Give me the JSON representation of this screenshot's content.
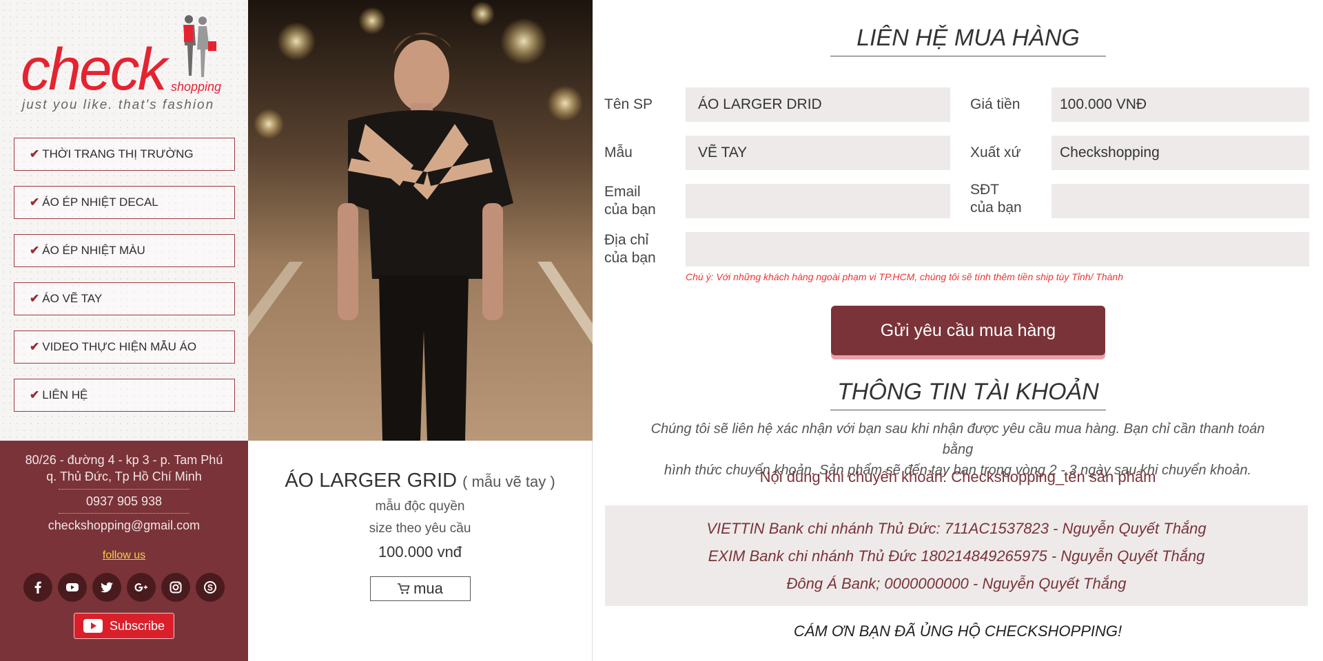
{
  "brand": {
    "logo_word": "check",
    "logo_sub": "shopping",
    "tagline": "just you like. that's fashion",
    "accent_color": "#e52330",
    "dark_color": "#7a3338"
  },
  "menu": {
    "items": [
      {
        "label": "THỜI TRANG THỊ TRƯỜNG"
      },
      {
        "label": "ÁO ÉP NHIỆT DECAL"
      },
      {
        "label": "ÁO ÉP NHIỆT MÀU"
      },
      {
        "label": "ÁO VẼ TAY"
      },
      {
        "label": "VIDEO THỰC HIỆN MẪU ÁO"
      },
      {
        "label": "LIÊN HỆ"
      }
    ],
    "check_icon": "check-icon"
  },
  "contact": {
    "address_line1": "80/26 - đường 4 - kp 3 - p. Tam Phú",
    "address_line2": "q. Thủ Đức, Tp Hồ Chí Minh",
    "phone": "0937 905 938",
    "email": "checkshopping@gmail.com",
    "follow_label": "follow us",
    "socials": [
      "facebook-icon",
      "youtube-icon",
      "twitter-icon",
      "google-plus-icon",
      "instagram-icon",
      "skype-icon"
    ],
    "subscribe_label": "Subscribe"
  },
  "product": {
    "name": "ÁO LARGER GRID",
    "style": "( mẫu vẽ tay )",
    "line1": "mẫu độc quyền",
    "line2": "size theo yêu cầu",
    "price": "100.000 vnđ",
    "buy_label": "mua"
  },
  "order_form": {
    "title": "LIÊN HỆ MUA HÀNG",
    "product_label": "Tên SP",
    "product_value": "ÁO LARGER DRID",
    "price_label": "Giá tiền",
    "price_value": "100.000 VNĐ",
    "design_label": "Mẫu",
    "design_value": "VẼ TAY",
    "origin_label": "Xuất xứ",
    "origin_value": "Checkshopping",
    "email_label_1": "Email",
    "email_label_2": "của bạn",
    "email_value": "",
    "phone_label_1": "SĐT",
    "phone_label_2": "của bạn",
    "phone_value": "",
    "address_label_1": "Địa chỉ",
    "address_label_2": "của bạn",
    "address_value": "",
    "note": "Chú ý: Với những khách hàng ngoài phạm vi TP.HCM, chúng tôi sẽ tính thêm tiền ship tùy Tỉnh/ Thành",
    "submit_label": "Gửi yêu cầu mua hàng"
  },
  "account": {
    "title": "THÔNG TIN TÀI KHOẢN",
    "intro_line1": "Chúng tôi sẽ liên hệ xác nhận với bạn sau khi nhận được yêu cầu mua hàng. Bạn chỉ cần thanh toán bằng",
    "intro_line2": "hình thức chuyển khoản. Sản phẩm sẽ đến tay bạn trong vòng 2 - 3 ngày sau khi chuyển khoản.",
    "transfer_content": "Nội dung khi chuyển khoản:  Checkshopping_tên sản phẩm",
    "banks": [
      "VIETTIN Bank chi nhánh Thủ Đức: 711AC1537823 - Nguyễn Quyết Thắng",
      "EXIM Bank chi nhánh Thủ Đức 180214849265975 - Nguyễn Quyết Thắng",
      "Đông Á Bank; 0000000000 - Nguyễn Quyết Thắng"
    ],
    "thanks": "CÁM ƠN BẠN ĐÃ ỦNG HỘ CHECKSHOPPING!"
  }
}
